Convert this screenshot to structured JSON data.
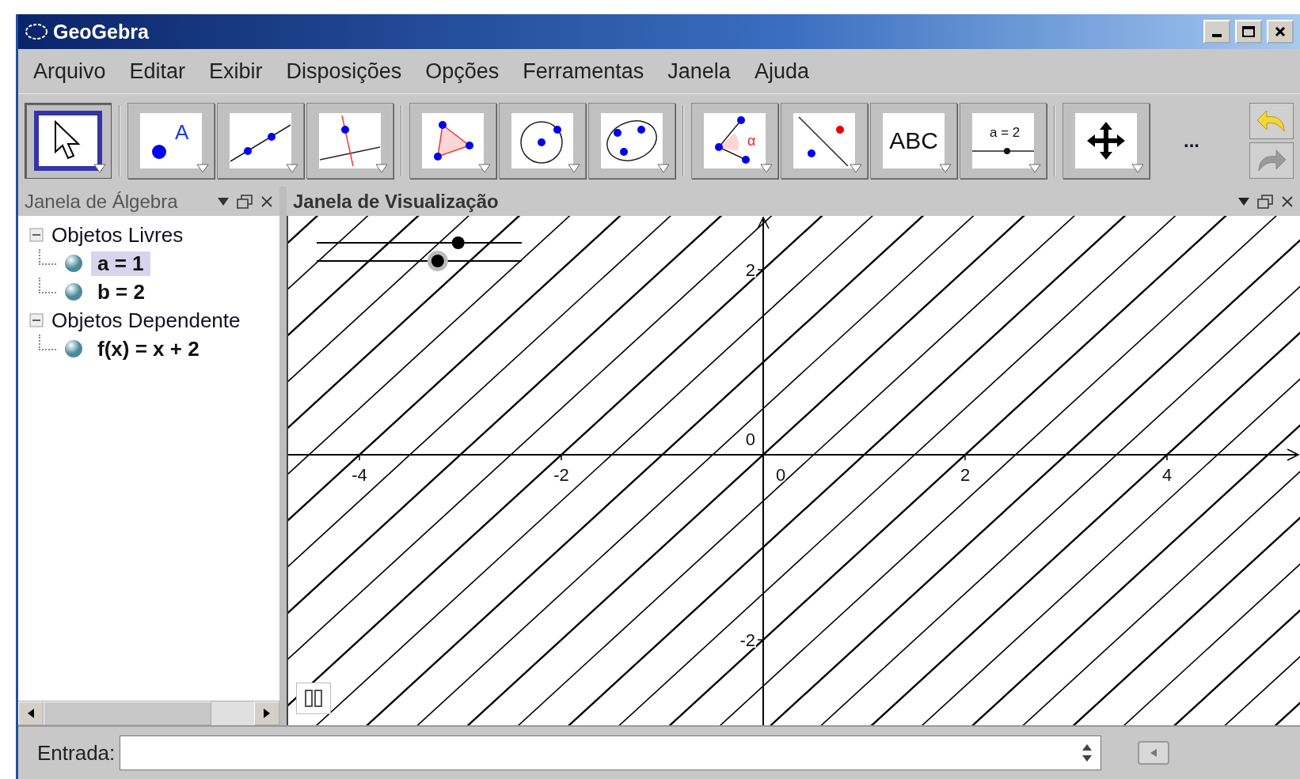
{
  "window": {
    "title": "GeoGebra"
  },
  "menu": [
    "Arquivo",
    "Editar",
    "Exibir",
    "Disposições",
    "Opções",
    "Ferramentas",
    "Janela",
    "Ajuda"
  ],
  "tools": [
    {
      "kind": "move",
      "selected": true
    },
    {
      "kind": "point",
      "label": "A",
      "selected": false
    },
    {
      "kind": "line",
      "selected": false
    },
    {
      "kind": "perpendicular",
      "selected": false
    },
    {
      "kind": "polygon",
      "selected": false
    },
    {
      "kind": "circle",
      "selected": false
    },
    {
      "kind": "conic",
      "selected": false
    },
    {
      "kind": "angle",
      "label": "α",
      "selected": false
    },
    {
      "kind": "reflect",
      "selected": false
    },
    {
      "kind": "text",
      "label": "ABC",
      "selected": false
    },
    {
      "kind": "slider",
      "label": "a = 2",
      "selected": false
    },
    {
      "kind": "pan",
      "selected": false
    }
  ],
  "more": "...",
  "undo": {
    "disabled": false
  },
  "redo": {
    "disabled": true
  },
  "algebra_view": {
    "title": "Janela de Álgebra",
    "groups": [
      {
        "label": "Objetos Livres",
        "expanded": true,
        "children": [
          {
            "label": "a = 1",
            "selected": true
          },
          {
            "label": "b = 2",
            "selected": false
          }
        ]
      },
      {
        "label": "Objetos Dependente",
        "expanded": true,
        "children": [
          {
            "label": "f(x) = x + 2",
            "selected": false
          }
        ]
      }
    ]
  },
  "graphics_view": {
    "title": "Janela de Visualização",
    "sliders": [
      {
        "level": 0.69,
        "highlighted": false
      },
      {
        "level": 0.59,
        "highlighted": true
      }
    ],
    "xtick_labels": [
      "-4",
      "-2",
      "0",
      "2",
      "4"
    ],
    "ytick_labels": [
      "2",
      "0",
      "-2"
    ]
  },
  "input_bar": {
    "label": "Entrada:"
  }
}
